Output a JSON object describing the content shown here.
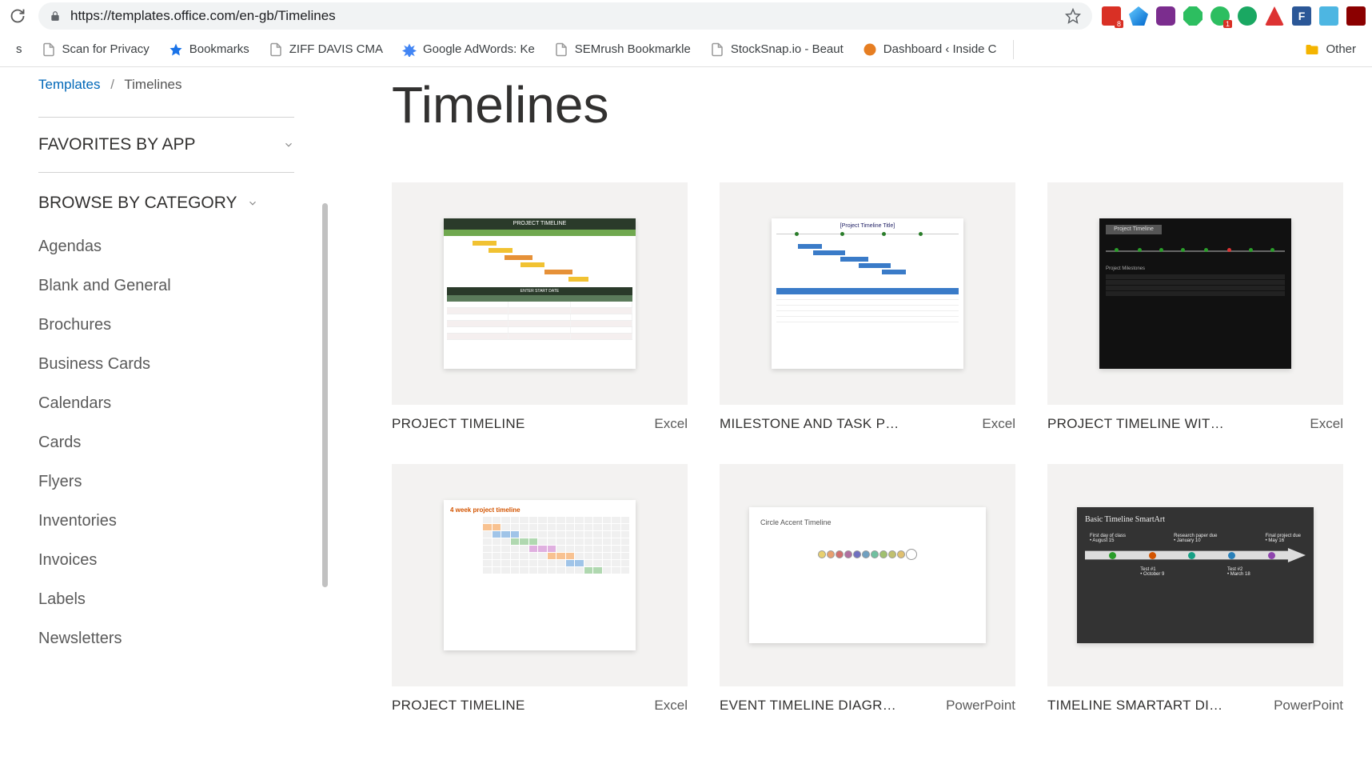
{
  "browser": {
    "url": "https://templates.office.com/en-gb/Timelines",
    "bookmarks": [
      {
        "label": "s"
      },
      {
        "label": "Scan for Privacy"
      },
      {
        "label": "Bookmarks"
      },
      {
        "label": "ZIFF DAVIS CMA"
      },
      {
        "label": "Google AdWords: Ke"
      },
      {
        "label": "SEMrush Bookmarkle"
      },
      {
        "label": "StockSnap.io - Beaut"
      },
      {
        "label": "Dashboard ‹ Inside C"
      }
    ],
    "other_bookmarks": "Other",
    "ext_badge1": "8",
    "ext_badge2": "1"
  },
  "breadcrumb": {
    "root": "Templates",
    "sep": "/",
    "current": "Timelines"
  },
  "sidebar": {
    "favorites": "FAVORITES BY APP",
    "browse": "BROWSE BY CATEGORY",
    "categories": [
      "Agendas",
      "Blank and General",
      "Brochures",
      "Business Cards",
      "Calendars",
      "Cards",
      "Flyers",
      "Inventories",
      "Invoices",
      "Labels",
      "Newsletters"
    ]
  },
  "page": {
    "title": "Timelines"
  },
  "templates": [
    {
      "title": "PROJECT TIMELINE",
      "app": "Excel",
      "thumb_title": "PROJECT TIMELINE",
      "thumb_sub": "ENTER START DATE"
    },
    {
      "title": "MILESTONE AND TASK P…",
      "app": "Excel",
      "thumb_title": "[Project Timeline Title]"
    },
    {
      "title": "PROJECT TIMELINE WIT…",
      "app": "Excel",
      "thumb_title": "Project Timeline",
      "thumb_sub": "Project Milestones"
    },
    {
      "title": "PROJECT TIMELINE",
      "app": "Excel",
      "thumb_title": "4 week project timeline"
    },
    {
      "title": "EVENT TIMELINE DIAGR…",
      "app": "PowerPoint",
      "thumb_title": "Circle Accent Timeline"
    },
    {
      "title": "TIMELINE SMARTART DI…",
      "app": "PowerPoint",
      "thumb_title": "Basic Timeline SmartArt",
      "labels": [
        "First day of class",
        "Research paper due",
        "Final project due"
      ],
      "dates": [
        "• August 15",
        "• January 10",
        "• May 16"
      ],
      "sub": [
        "Test #1",
        "Test #2"
      ],
      "subdates": [
        "• October 9",
        "• March 18"
      ]
    }
  ]
}
